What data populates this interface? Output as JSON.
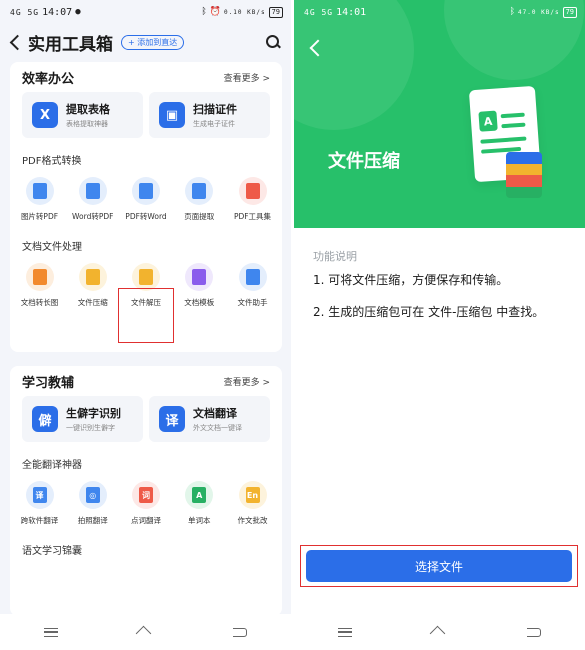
{
  "left_screen": {
    "status": {
      "network": "4G 5G",
      "time": "14:07",
      "battery": "79",
      "speed": "0.10 KB/s"
    },
    "header": {
      "title": "实用工具箱",
      "add_label": "+ 添加到直达"
    },
    "office_card": {
      "title": "效率办公",
      "more": "查看更多 >",
      "big_items": [
        {
          "title": "提取表格",
          "subtitle": "表格提取神器",
          "icon": "excel-x-icon",
          "color": "#2b6ee8"
        },
        {
          "title": "扫描证件",
          "subtitle": "生成电子证件",
          "icon": "id-card-icon",
          "color": "#2b6ee8"
        }
      ],
      "pdf_section": {
        "label": "PDF格式转换",
        "items": [
          {
            "label": "图片转PDF",
            "icon": "image-to-pdf-icon",
            "bg": "#e4eefc",
            "fg": "#3f86ee"
          },
          {
            "label": "Word转PDF",
            "icon": "word-to-pdf-icon",
            "bg": "#e4eefc",
            "fg": "#3f86ee"
          },
          {
            "label": "PDF转Word",
            "icon": "pdf-to-word-icon",
            "bg": "#e4eefc",
            "fg": "#3f86ee"
          },
          {
            "label": "页面提取",
            "icon": "page-extract-icon",
            "bg": "#e4eefc",
            "fg": "#3f86ee"
          },
          {
            "label": "PDF工具集",
            "icon": "pdf-tools-icon",
            "bg": "#fde8e6",
            "fg": "#ee5a48"
          }
        ]
      },
      "doc_section": {
        "label": "文档文件处理",
        "items": [
          {
            "label": "文档转长图",
            "icon": "doc-to-image-icon",
            "bg": "#fdeede",
            "fg": "#f28a2e"
          },
          {
            "label": "文件压缩",
            "icon": "file-compress-icon",
            "bg": "#fdf3dc",
            "fg": "#f2b32e"
          },
          {
            "label": "文件解压",
            "icon": "file-extract-icon",
            "bg": "#fdf3dc",
            "fg": "#f2b32e"
          },
          {
            "label": "文档模板",
            "icon": "doc-template-icon",
            "bg": "#efe8fc",
            "fg": "#8a5cec"
          },
          {
            "label": "文件助手",
            "icon": "file-assistant-icon",
            "bg": "#e4eefc",
            "fg": "#3f86ee"
          }
        ]
      }
    },
    "study_card": {
      "title": "学习教辅",
      "more": "查看更多 >",
      "big_items": [
        {
          "title": "生僻字识别",
          "subtitle": "一键识别生僻字",
          "icon": "rare-char-icon",
          "color": "#2b6ee8",
          "glyph": "僻"
        },
        {
          "title": "文档翻译",
          "subtitle": "外文文档一键译",
          "icon": "doc-translate-icon",
          "color": "#2b6ee8",
          "glyph": "译"
        }
      ],
      "translate_section": {
        "label": "全能翻译神器",
        "items": [
          {
            "label": "跨软件翻译",
            "icon": "cross-app-translate-icon",
            "bg": "#e4eefc",
            "fg": "#3f86ee",
            "glyph": "译"
          },
          {
            "label": "拍照翻译",
            "icon": "photo-translate-icon",
            "bg": "#e4eefc",
            "fg": "#3f86ee",
            "glyph": "◎"
          },
          {
            "label": "点词翻译",
            "icon": "word-tap-translate-icon",
            "bg": "#fde8e6",
            "fg": "#ee5a48",
            "glyph": "词"
          },
          {
            "label": "单词本",
            "icon": "vocabulary-book-icon",
            "bg": "#e2f6ea",
            "fg": "#27b063",
            "glyph": "A"
          },
          {
            "label": "作文批改",
            "icon": "essay-correct-icon",
            "bg": "#fdf3dc",
            "fg": "#f2b32e",
            "glyph": "En"
          }
        ]
      },
      "chinese_section": {
        "label": "语文学习锦囊"
      }
    }
  },
  "right_screen": {
    "status": {
      "network": "4G 5G",
      "time": "14:01",
      "battery": "79",
      "speed": "47.0 KB/s"
    },
    "hero": {
      "title": "文件压缩",
      "doc_letter": "A"
    },
    "description": {
      "heading": "功能说明",
      "point1": "1. 可将文件压缩，方便保存和传输。",
      "point2": "2. 生成的压缩包可在 文件-压缩包 中查找。"
    },
    "primary_button": "选择文件"
  },
  "colors": {
    "accent": "#2b6ee8",
    "hero_green": "#27c06a",
    "highlight": "#e03030"
  }
}
